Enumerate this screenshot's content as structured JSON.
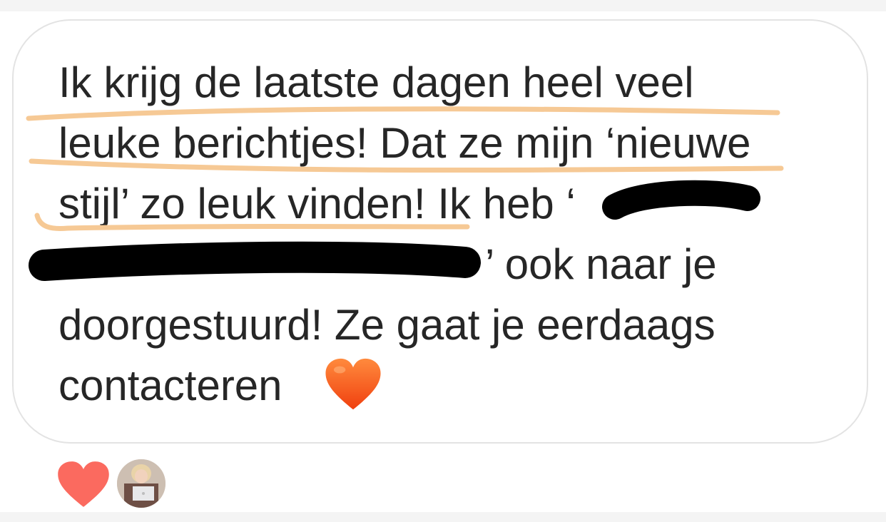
{
  "message": {
    "lines": [
      "Ik krijg de laatste dagen heel veel",
      "leuke berichtjes! Dat ze mijn ‘nieuwe",
      "stijl’ zo leuk vinden! Ik heb ‘",
      "’ ook naar je",
      "doorgestuurd! Ze gaat je eerdaags",
      "contacteren"
    ],
    "emoji_icon": "orange-heart-icon"
  },
  "reactions": {
    "heart_icon": "red-heart-icon",
    "avatar_icon": "user-avatar"
  },
  "colors": {
    "text": "#262626",
    "underline": "#f6c995",
    "redaction": "#000000",
    "bubble_border": "#e3e3e3",
    "reaction_heart": "#fb6a5f",
    "emoji_heart": "#f5521c"
  }
}
